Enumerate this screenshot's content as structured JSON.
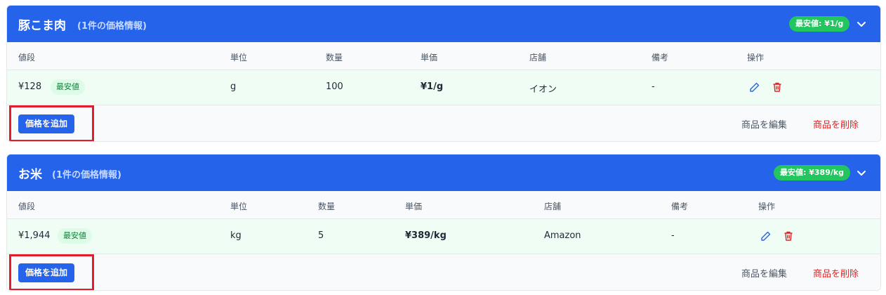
{
  "colors": {
    "header_bg": "#2563eb",
    "best_badge_bg": "#22c55e",
    "lowest_tag_bg": "#dcfce7",
    "highlight_row_bg": "#f0fdf4",
    "delete_red": "#dc2626",
    "annotation_red": "#e11d2e"
  },
  "columns": {
    "price": "値段",
    "unit": "単位",
    "qty": "数量",
    "unit_price": "単価",
    "store": "店舗",
    "note": "備考",
    "actions": "操作"
  },
  "products": [
    {
      "name": "豚こま肉",
      "count_label": "(1件の価格情報)",
      "best_badge": "最安値: ¥1/g",
      "rows": [
        {
          "price": "¥128",
          "lowest_tag": "最安値",
          "unit": "g",
          "qty": "100",
          "unit_price": "¥1/g",
          "store": "イオン",
          "note": "-"
        }
      ],
      "add_price_label": "価格を追加",
      "edit_label": "商品を編集",
      "delete_label": "商品を削除"
    },
    {
      "name": "お米",
      "count_label": "(1件の価格情報)",
      "best_badge": "最安値: ¥389/kg",
      "rows": [
        {
          "price": "¥1,944",
          "lowest_tag": "最安値",
          "unit": "kg",
          "qty": "5",
          "unit_price": "¥389/kg",
          "store": "Amazon",
          "note": "-"
        }
      ],
      "add_price_label": "価格を追加",
      "edit_label": "商品を編集",
      "delete_label": "商品を削除"
    }
  ],
  "icons": {
    "expand": "chevron-down-icon",
    "edit": "pencil-icon",
    "delete": "trash-icon"
  }
}
